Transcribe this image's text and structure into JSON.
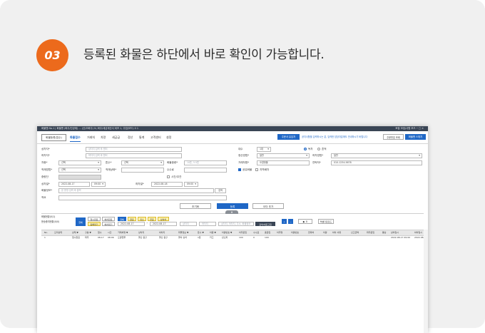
{
  "step": {
    "number": "03",
    "text": "등록된 화물은 하단에서 바로 확인이 가능합니다.",
    "color": "#ec6a1c"
  },
  "window": {
    "titlebar_left": "화물맨 No.1 | 화물맨 (화주/단공제) ... (신/오화주) N, 화주/세금계산서 비즈 1, 주업(모드) 0 1",
    "titlebar_right": "토탈 모집/사원 모드   ─  □  ✕",
    "logo": "화물등록(접수)",
    "menus": [
      "화물접수",
      "거래처",
      "차량",
      "세금급",
      "정산",
      "통계",
      "고객센터",
      "설정"
    ],
    "notice_btn": "주문서 유입처",
    "notice_text": "공지사항을 입력하시는 분, 입력한 담당자분께도 안내하시기 바랍니다",
    "func_btn": "주문번호 조회",
    "right_btn": "화물맨 스위치"
  },
  "form": {
    "shipper_label": "상차지*",
    "shipper_ph": "상차지 입력 후 엔터",
    "receiver_label": "하차지*",
    "receiver_ph": "하차지 입력 후 엔터",
    "car_label": "차종*",
    "car_value": "선택",
    "ton_label": "톤수*",
    "ton_value": "선택",
    "weight_label": "화물중량*",
    "weight_ph": "10톤, 5.5톤",
    "loadmethod_label": "적재방법*",
    "loadmethod_value": "선택",
    "loadstate_label": "적재상태*",
    "loadstate_value": "",
    "unload_label": "수수료",
    "unload_value": "",
    "extra_label": "중량단",
    "extra_value": "",
    "time_label": "시간/무관",
    "loaddate_label": "상차일*",
    "loaddate_value": "2022-08-17",
    "loadtime_value": "09:00",
    "unloaddate_label": "하차일*",
    "unloaddate_value": "2022-08-18",
    "unloadtime_value": "09:00",
    "cargo_label": "화물정보*",
    "cargo_ph": "본 운영 입력 후 출력",
    "cargo_btn": "검색",
    "memo_label": "적요",
    "r_count_label": "대수",
    "r_count_value": "1대",
    "r_radio1": "독차",
    "r_radio2": "혼적",
    "r_pay_label": "정산방법*",
    "r_pay_value": "일반",
    "r_unloadmethod_label": "하차방법*",
    "r_unloadmethod_value": "일반",
    "r_client_label": "거래처명*",
    "r_client_value": "오경현물",
    "r_phone_label": "연락처*",
    "r_phone_value": "010-1234-5678",
    "r_check1": "공유화물",
    "r_check2": "지역배차"
  },
  "actions": {
    "reset": "초기화",
    "register": "등록",
    "prev": "오더 추가"
  },
  "list": {
    "title_line1": "화물현황(0/1)",
    "title_line2": "운송중개현황(0/0)",
    "all_btn": "전체",
    "filters1": [
      "접수완료",
      "배차완료"
    ],
    "filters2": [
      "등록대기",
      "배차대기"
    ],
    "chips": [
      "전체",
      "완료",
      "취소",
      "무료",
      "상하차"
    ],
    "date_from": "2022-08-17",
    "date_to": "2022-08-17",
    "search_ph1": "상차지",
    "search_ph2": "하차지",
    "search_ph3": "상차지, 하차지, 주소, 화물정보",
    "search_btn": "검색/새로고침",
    "count_text": "▶ 0",
    "excel_btn": "엑셀다운로드",
    "headers": [
      "No.",
      "오더상태",
      "상태 ▼",
      "구분 ▼",
      "접수",
      "시간",
      "거래처명 ▼",
      "상차지",
      "하차지",
      "화물정보 ▼",
      "톤수 ▼",
      "차종 ▼",
      "차량번호 ▼",
      "차주운임",
      "수수료",
      "총운임",
      "차주명",
      "차량번호",
      "연락처",
      "차량",
      "하차 서류",
      "신고금액",
      "화주운임",
      "통상",
      "상차일시",
      "하차일시"
    ],
    "rows": [
      [
        "1",
        "",
        "접수완료",
        "화주",
        "08-17",
        "08:06",
        "오경현물",
        "울산 중구",
        "울산 중구",
        "울차 상차",
        "1톤",
        "카고",
        "반소파",
        "100",
        "0",
        "100",
        "",
        "",
        "",
        "",
        "",
        "",
        "",
        "",
        "2022-08-17 09:00",
        "2022-08-"
      ]
    ]
  }
}
